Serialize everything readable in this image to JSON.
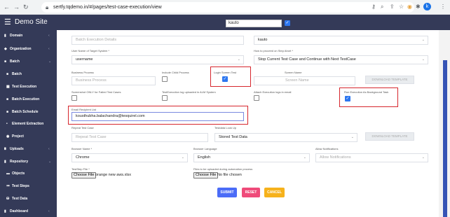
{
  "browser": {
    "url": "sertfy.tqdemo.in/#/pages/test-case-execution/view",
    "profile_initial": "k"
  },
  "header": {
    "brand": "Demo Site",
    "search_value": "kauto",
    "user_name": "Kousthubha balachandra"
  },
  "sidebar": {
    "items": [
      {
        "label": "Domain",
        "chev": "‹"
      },
      {
        "label": "Organization",
        "chev": "‹"
      },
      {
        "label": "Batch",
        "chev": "⌄"
      },
      {
        "label": "Batch",
        "chev": ""
      },
      {
        "label": "Test Execution",
        "chev": ""
      },
      {
        "label": "Batch Execution",
        "chev": ""
      },
      {
        "label": "Batch Schedule",
        "chev": ""
      },
      {
        "label": "Element Extraction",
        "chev": ""
      },
      {
        "label": "Project",
        "chev": ""
      },
      {
        "label": "Uploads",
        "chev": "‹"
      },
      {
        "label": "Repository",
        "chev": "⌄"
      },
      {
        "label": "Objects",
        "chev": ""
      },
      {
        "label": "Test Steps",
        "chev": ""
      },
      {
        "label": "Test Data",
        "chev": ""
      },
      {
        "label": "Dashboard",
        "chev": "‹"
      }
    ]
  },
  "form": {
    "batch_execution_details": {
      "placeholder": "Batch Execution Details"
    },
    "top_right_value": "kauto",
    "user_name_target": {
      "label": "User Name of Target System *",
      "value": "username"
    },
    "proceed_on_abort": {
      "label": "How to proceed on Step Abort *",
      "value": "Stop Current Test Case and Continue with Next TestCase"
    },
    "business_process": {
      "label": "Business Process",
      "placeholder": "Business Process"
    },
    "include_child_process": {
      "label": "Include Child Process"
    },
    "login_screen_test": {
      "label": "Login Screen Test"
    },
    "screen_name": {
      "label": "Screen Name",
      "placeholder": "Screen Name"
    },
    "download_template_1": "DOWNLOAD TEMPLATE",
    "screenshots_only_failed": {
      "label": "Screenshot ONLY for Failed Test Cases"
    },
    "log_uploaded_alm": {
      "label": "TestExecution log uploaded in ALM System"
    },
    "attach_log_email": {
      "label": "Attach Execution logs in email"
    },
    "run_background": {
      "label": "Run Execution As Background Task"
    },
    "email_recipient": {
      "label": "Email Recipient List",
      "value": "kousthubha.balachandra@tesquirel.com"
    },
    "repeat_test_case": {
      "label": "Repeat Test Case",
      "placeholder": "Repeat Test Case"
    },
    "testdata_lookup": {
      "label": "Testdata Look Up",
      "value": "Stored Test Data"
    },
    "download_template_2": "DOWNLOAD TEMPLATE",
    "browser_name": {
      "label": "Browser Name *",
      "value": "Chrome"
    },
    "browser_language": {
      "label": "Browser Language",
      "value": "English"
    },
    "allow_notifications": {
      "label": "Allow Notifications",
      "placeholder": "Allow Notifications"
    },
    "teststep_file": {
      "label": "TestStep File *",
      "button": "Choose File",
      "file": "orange new aws.xlsx"
    },
    "files_upload": {
      "label": "Files to be uploaded during automation process",
      "button": "Choose File",
      "file": "No file chosen"
    },
    "actions": {
      "submit": "SUBMIT",
      "reset": "RESET",
      "cancel": "CANCEL"
    }
  },
  "colors": {
    "appbar": "#343a58",
    "checkbox": "#2d77f0",
    "submit": "#4b6cf7",
    "reset": "#ef4b7a",
    "cancel": "#f6b21c",
    "highlight": "#d6262d"
  }
}
